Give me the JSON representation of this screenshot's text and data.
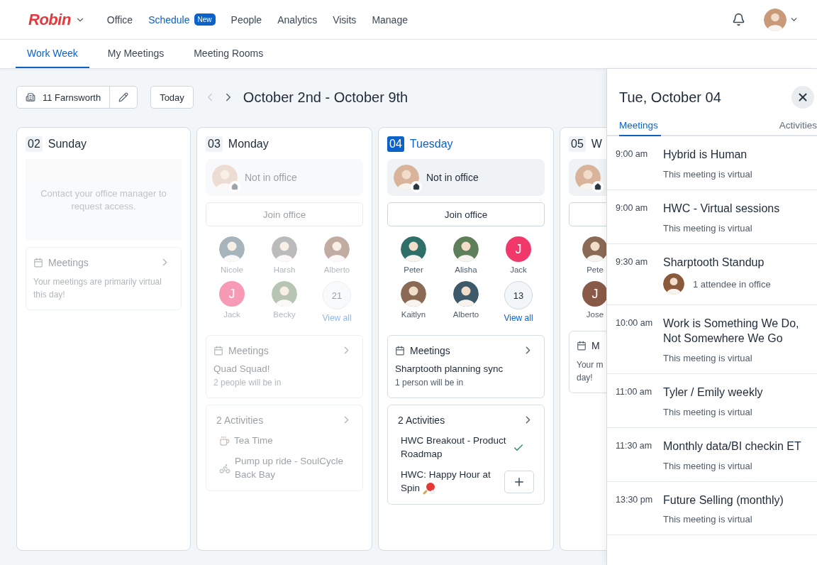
{
  "nav": {
    "logo": "Robin",
    "items": [
      {
        "label": "Office",
        "selected": false
      },
      {
        "label": "Schedule",
        "selected": true,
        "badge": "New"
      },
      {
        "label": "People",
        "selected": false
      },
      {
        "label": "Analytics",
        "selected": false
      },
      {
        "label": "Visits",
        "selected": false
      },
      {
        "label": "Manage",
        "selected": false
      }
    ]
  },
  "subtabs": [
    {
      "label": "Work Week",
      "selected": true
    },
    {
      "label": "My Meetings",
      "selected": false
    },
    {
      "label": "Meeting Rooms",
      "selected": false
    }
  ],
  "toolbar": {
    "location": "11 Farnsworth",
    "today": "Today",
    "prev": {
      "disabled": true
    },
    "next": {
      "disabled": false
    },
    "range": "October 2nd - October 9th"
  },
  "days": [
    {
      "number": "02",
      "name": "Sunday",
      "selected": false,
      "dimmed": true,
      "kind": "no_access",
      "message": "Contact your office manager to request access.",
      "meetings": {
        "title": "Meetings",
        "chevron": true,
        "note": "Your meetings are primarily virtual this day!"
      }
    },
    {
      "number": "03",
      "name": "Monday",
      "selected": false,
      "dimmed": true,
      "kind": "schedule",
      "status": "Not in office",
      "join": "Join office",
      "people_rows": [
        [
          {
            "kind": "photo",
            "name": "Nicole"
          },
          {
            "kind": "photo",
            "name": "Harsh"
          },
          {
            "kind": "photo",
            "name": "Alberto"
          }
        ],
        [
          {
            "kind": "initial",
            "initial": "J",
            "name": "Jack",
            "color": "#f79ab6"
          },
          {
            "kind": "photo",
            "name": "Becky"
          },
          {
            "kind": "more",
            "count": "21",
            "link": "View all"
          }
        ]
      ],
      "meetings": {
        "title": "Meetings",
        "chevron": true,
        "event": "Quad Squad!",
        "note": "2 people will be in"
      },
      "activities": {
        "title": "2 Activities",
        "items": [
          {
            "title": "Tea Time",
            "kind": "tea"
          },
          {
            "title": "Pump up ride - SoulCycle Back Bay",
            "kind": "bike"
          }
        ]
      }
    },
    {
      "number": "04",
      "name": "Tuesday",
      "selected": true,
      "dimmed": false,
      "kind": "schedule",
      "status": "Not in office",
      "join": "Join office",
      "people_rows": [
        [
          {
            "kind": "photo",
            "name": "Peter"
          },
          {
            "kind": "photo",
            "name": "Alisha"
          },
          {
            "kind": "initial",
            "initial": "J",
            "name": "Jack",
            "color": "#f0386b"
          }
        ],
        [
          {
            "kind": "photo",
            "name": "Kaitlyn"
          },
          {
            "kind": "photo",
            "name": "Alberto"
          },
          {
            "kind": "more",
            "count": "13",
            "link": "View all"
          }
        ]
      ],
      "meetings": {
        "title": "Meetings",
        "chevron": true,
        "event": "Sharptooth planning sync",
        "note": "1 person will be in"
      },
      "activities": {
        "title": "2 Activities",
        "items": [
          {
            "title": "HWC Breakout - Product Roadmap",
            "kind": "plain",
            "joined": true
          },
          {
            "title": "HWC: Happy Hour at Spin",
            "kind": "pingpong",
            "joined": false
          }
        ]
      }
    },
    {
      "number": "05",
      "name": "W",
      "selected": false,
      "dimmed": false,
      "kind": "schedule",
      "people_rows": [
        [
          {
            "kind": "photo",
            "name": "Pete"
          }
        ],
        [
          {
            "kind": "initial",
            "initial": "J",
            "name": "Jose",
            "color": "#8a5a48"
          }
        ]
      ],
      "meetings": {
        "title": "M",
        "note_lines": [
          "Your m",
          "day!"
        ]
      }
    }
  ],
  "drawer": {
    "title": "Tue, October 04",
    "tabs": [
      {
        "label": "Meetings",
        "selected": true
      },
      {
        "label": "Activities",
        "selected": false
      }
    ],
    "meetings": [
      {
        "time": "9:00 am",
        "title": "Hybrid is Human",
        "kind": "virtual",
        "note": "This meeting is virtual"
      },
      {
        "time": "9:00 am",
        "title": "HWC - Virtual sessions",
        "kind": "virtual",
        "note": "This meeting is virtual"
      },
      {
        "time": "9:30 am",
        "title": "Sharptooth Standup",
        "kind": "in_office",
        "note": "1 attendee in office"
      },
      {
        "time": "10:00 am",
        "title": "Work is Something We Do, Not Somewhere We Go",
        "kind": "virtual",
        "note": "This meeting is virtual"
      },
      {
        "time": "11:00 am",
        "title": "Tyler / Emily weekly",
        "kind": "virtual",
        "note": "This meeting is virtual"
      },
      {
        "time": "11:30 am",
        "title": "Monthly data/BI checkin ET",
        "kind": "virtual",
        "note": "This meeting is virtual"
      },
      {
        "time": "13:30 pm",
        "title": "Future Selling (monthly)",
        "kind": "virtual",
        "note": "This meeting is virtual"
      }
    ]
  }
}
